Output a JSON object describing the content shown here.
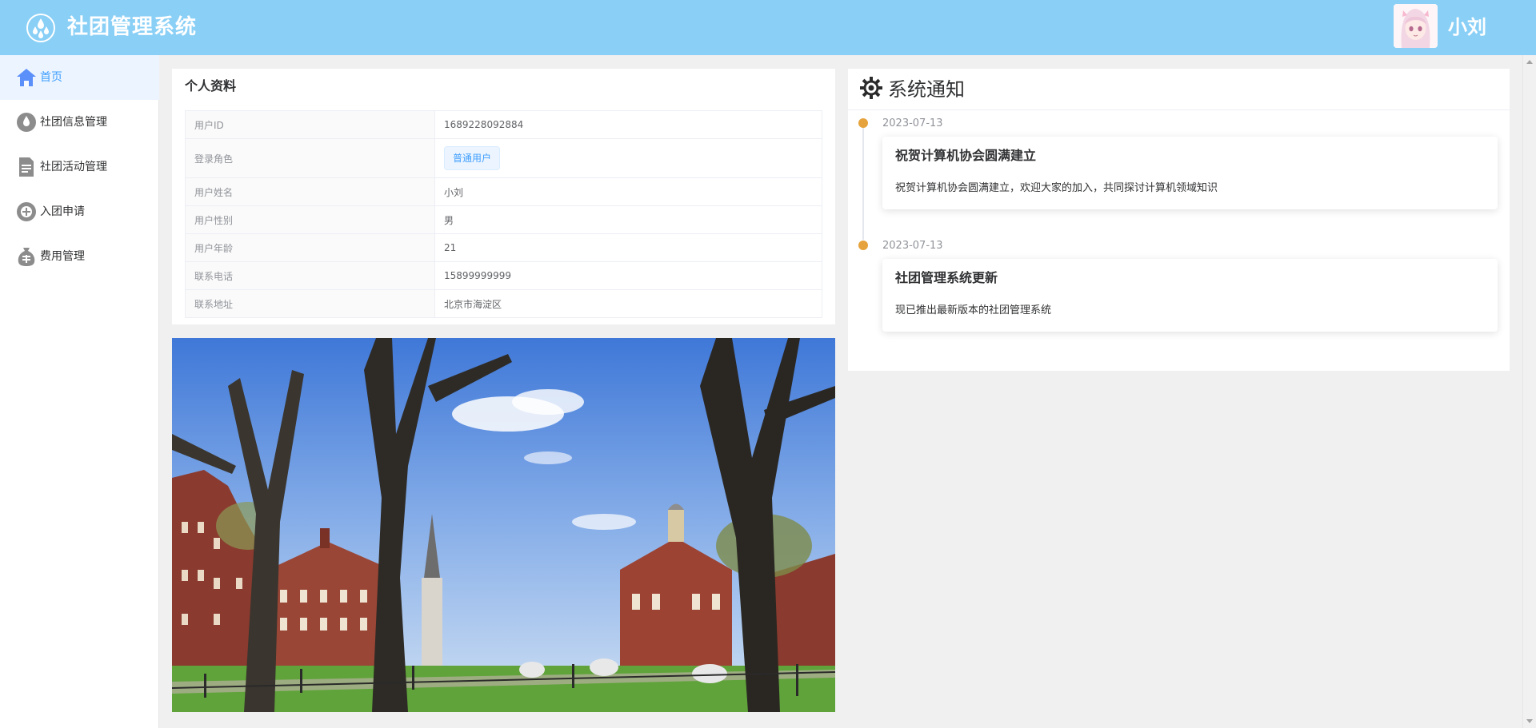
{
  "header": {
    "app_title": "社团管理系统",
    "logo_icon": "droplets-logo-icon",
    "username": "小刘",
    "bg_color": "#89cff6"
  },
  "sidebar": {
    "items": [
      {
        "label": "首页",
        "icon": "home-icon",
        "active": true
      },
      {
        "label": "社团信息管理",
        "icon": "drop-icon",
        "active": false
      },
      {
        "label": "社团活动管理",
        "icon": "document-icon",
        "active": false
      },
      {
        "label": "入团申请",
        "icon": "add-circle-icon",
        "active": false
      },
      {
        "label": "费用管理",
        "icon": "money-bag-icon",
        "active": false
      }
    ]
  },
  "profile": {
    "title": "个人资料",
    "rows": [
      {
        "label": "用户ID",
        "value": "1689228092884"
      },
      {
        "label": "登录角色",
        "value": "普通用户"
      },
      {
        "label": "用户姓名",
        "value": "小刘"
      },
      {
        "label": "用户性别",
        "value": "男"
      },
      {
        "label": "用户年龄",
        "value": "21"
      },
      {
        "label": "联系电话",
        "value": "15899999999"
      },
      {
        "label": "联系地址",
        "value": "北京市海淀区"
      }
    ]
  },
  "notices": {
    "title": "系统通知",
    "items": [
      {
        "date": "2023-07-13",
        "title": "祝贺计算机协会圆满建立",
        "body": "祝贺计算机协会圆满建立，欢迎大家的加入，共同探讨计算机领域知识"
      },
      {
        "date": "2023-07-13",
        "title": "社团管理系统更新",
        "body": "现已推出最新版本的社团管理系统"
      }
    ],
    "dot_color": "#e6a23c"
  },
  "colors": {
    "accent": "#409eff",
    "active_bg": "#ecf5ff"
  }
}
